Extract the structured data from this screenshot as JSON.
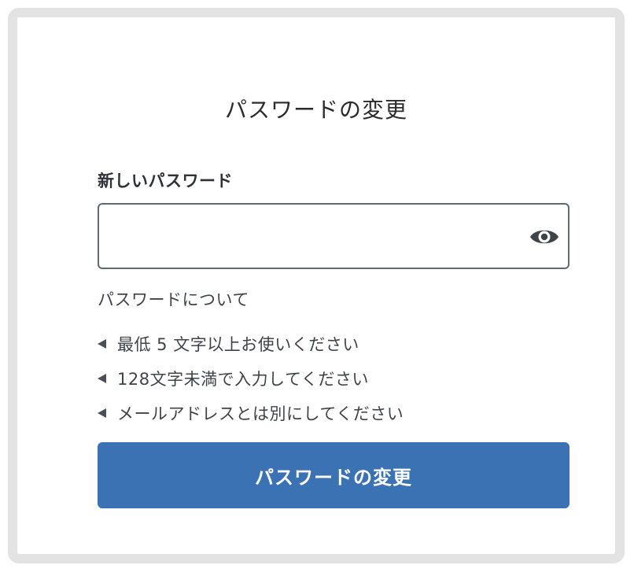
{
  "page": {
    "title": "パスワードの変更"
  },
  "form": {
    "new_password_label": "新しいパスワード",
    "new_password_value": "",
    "new_password_placeholder": "",
    "visibility_toggle_icon": "eye-icon",
    "submit_label": "パスワードの変更"
  },
  "requirements": {
    "heading": "パスワードについて",
    "bullet_icon": "triangle-left-icon",
    "items": [
      "最低 5 文字以上お使いください",
      "128文字未満で入力してください",
      "メールアドレスとは別にしてください"
    ]
  },
  "colors": {
    "primary_button": "#3b72b3",
    "input_border": "#5e6a75",
    "frame_border": "#e3e3e3"
  }
}
